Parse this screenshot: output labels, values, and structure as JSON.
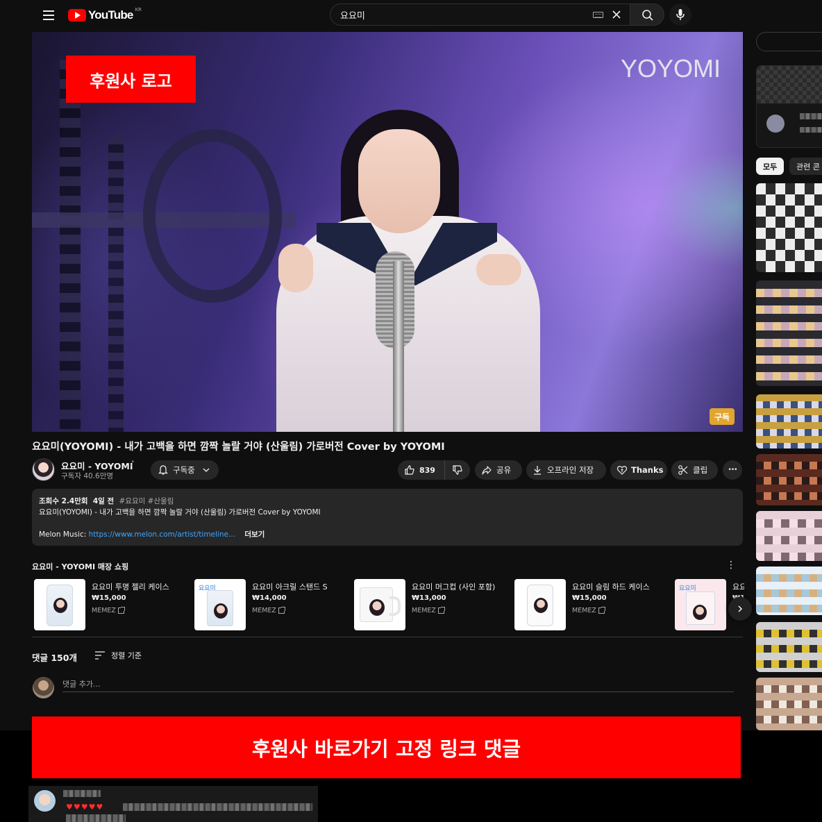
{
  "header": {
    "logo_text": "YouTube",
    "region": "KR",
    "search_value": "요요미"
  },
  "video": {
    "watermark": "YOYOMI",
    "sponsor_logo": "후원사 로고",
    "subscribe_badge": "구독",
    "title": "요요미(YOYOMI) - 내가 고백을 하면 깜짝 놀랄 거야 (산울림) 가로버전 Cover by YOYOMI"
  },
  "channel": {
    "name": "요요미 - YOYOMI",
    "note_icon": "♪",
    "subscribers": "구독자 40.6만명"
  },
  "actions": {
    "subscribed": "구독중",
    "likes": "839",
    "share": "공유",
    "offline": "오프라인 저장",
    "thanks": "Thanks",
    "clip": "클립",
    "more": "•••"
  },
  "description": {
    "views": "조회수 2.4만회",
    "age": "4일 전",
    "tags": "#요요미 #산울림",
    "line1": "요요미(YOYOMI) - 내가 고백을 하면 깜짝 놀랄 거야 (산울림) 가로버전 Cover by YOYOMI",
    "melon_label": "Melon Music:",
    "melon_link": "https://www.melon.com/artist/timeline...",
    "more": "더보기"
  },
  "shopping": {
    "title": "요요미 - YOYOMI 매장 쇼핑",
    "items": [
      {
        "name": "요요미 투명 젤리 케이스",
        "price": "₩15,000",
        "seller": "MEMEZ"
      },
      {
        "name": "요요미 아크릴 스탠드 S",
        "price": "₩14,000",
        "seller": "MEMEZ"
      },
      {
        "name": "요요미 머그컵 (사인 포함)",
        "price": "₩13,000",
        "seller": "MEMEZ"
      },
      {
        "name": "요요미 슬림 하드 케이스",
        "price": "₩15,000",
        "seller": "MEMEZ"
      },
      {
        "name": "요요",
        "price": "₩1",
        "seller": ""
      }
    ],
    "thumb_brand": "요요미"
  },
  "comments": {
    "count": "댓글 150개",
    "sort": "정렬 기준",
    "add_placeholder": "댓글 추가...",
    "pinned_hearts": "♥♥♥♥♥"
  },
  "sponsor_link": "후원사 바로가기 고정 링크 댓글",
  "sidebar": {
    "chip_all": "모두",
    "chip_related": "관련 콘"
  },
  "colors": {
    "accent_red": "#ff0000",
    "link_blue": "#3ea6ff",
    "bg": "#0f0f0f"
  }
}
